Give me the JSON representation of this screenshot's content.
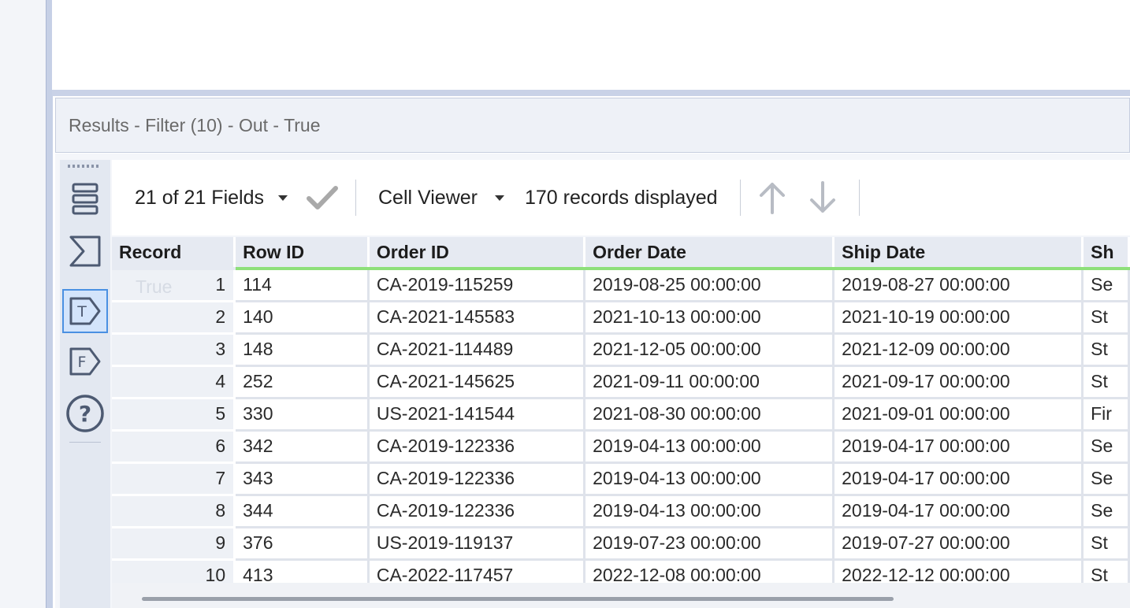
{
  "results_header": {
    "title": "Results - Filter (10) - Out - True"
  },
  "toolbar": {
    "fields_label": "21 of 21 Fields",
    "viewer_label": "Cell Viewer",
    "records_label": "170 records displayed"
  },
  "side_toolbar": {
    "items": [
      "list-view-icon",
      "sum-icon",
      "true-anchor-icon",
      "false-anchor-icon",
      "help-icon"
    ],
    "true_letter": "T",
    "false_letter": "F",
    "help_glyph": "?",
    "active": "true-anchor-icon"
  },
  "grid": {
    "columns": [
      "Record",
      "Row ID",
      "Order ID",
      "Order Date",
      "Ship Date",
      "Sh"
    ],
    "ghost_label": "True",
    "rows": [
      [
        "1",
        "114",
        "CA-2019-115259",
        "2019-08-25 00:00:00",
        "2019-08-27 00:00:00",
        "Se"
      ],
      [
        "2",
        "140",
        "CA-2021-145583",
        "2021-10-13 00:00:00",
        "2021-10-19 00:00:00",
        "St"
      ],
      [
        "3",
        "148",
        "CA-2021-114489",
        "2021-12-05 00:00:00",
        "2021-12-09 00:00:00",
        "St"
      ],
      [
        "4",
        "252",
        "CA-2021-145625",
        "2021-09-11 00:00:00",
        "2021-09-17 00:00:00",
        "St"
      ],
      [
        "5",
        "330",
        "US-2021-141544",
        "2021-08-30 00:00:00",
        "2021-09-01 00:00:00",
        "Fir"
      ],
      [
        "6",
        "342",
        "CA-2019-122336",
        "2019-04-13 00:00:00",
        "2019-04-17 00:00:00",
        "Se"
      ],
      [
        "7",
        "343",
        "CA-2019-122336",
        "2019-04-13 00:00:00",
        "2019-04-17 00:00:00",
        "Se"
      ],
      [
        "8",
        "344",
        "CA-2019-122336",
        "2019-04-13 00:00:00",
        "2019-04-17 00:00:00",
        "Se"
      ],
      [
        "9",
        "376",
        "US-2019-119137",
        "2019-07-23 00:00:00",
        "2019-07-27 00:00:00",
        "St"
      ],
      [
        "10",
        "413",
        "CA-2022-117457",
        "2022-12-08 00:00:00",
        "2022-12-12 00:00:00",
        "St"
      ]
    ]
  },
  "colors": {
    "accent": "#4a90e2",
    "header_underline": "#8ee07a",
    "panel": "#eef1f7"
  }
}
